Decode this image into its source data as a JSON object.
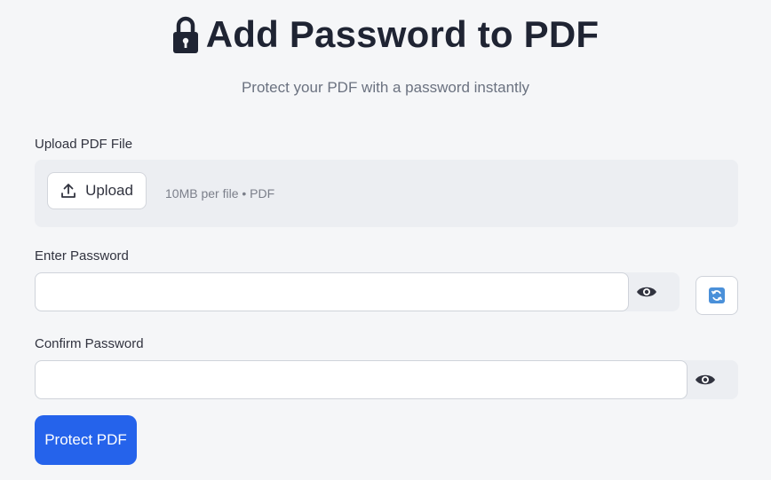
{
  "header": {
    "title": "Add Password to PDF",
    "subtitle": "Protect your PDF with a password instantly",
    "title_icon": "lock-icon"
  },
  "upload": {
    "label": "Upload PDF File",
    "button_label": "Upload",
    "button_icon": "upload-icon",
    "hint": "10MB per file • PDF"
  },
  "password": {
    "label": "Enter Password",
    "value": "",
    "toggle_icon": "eye-icon",
    "generate_icon": "refresh-icon"
  },
  "confirm_password": {
    "label": "Confirm Password",
    "value": "",
    "toggle_icon": "eye-icon"
  },
  "actions": {
    "protect_label": "Protect PDF"
  },
  "colors": {
    "background": "#f5f6f8",
    "primary": "#2563eb",
    "title": "#1f2433",
    "refresh_icon": "#4a90d9"
  }
}
